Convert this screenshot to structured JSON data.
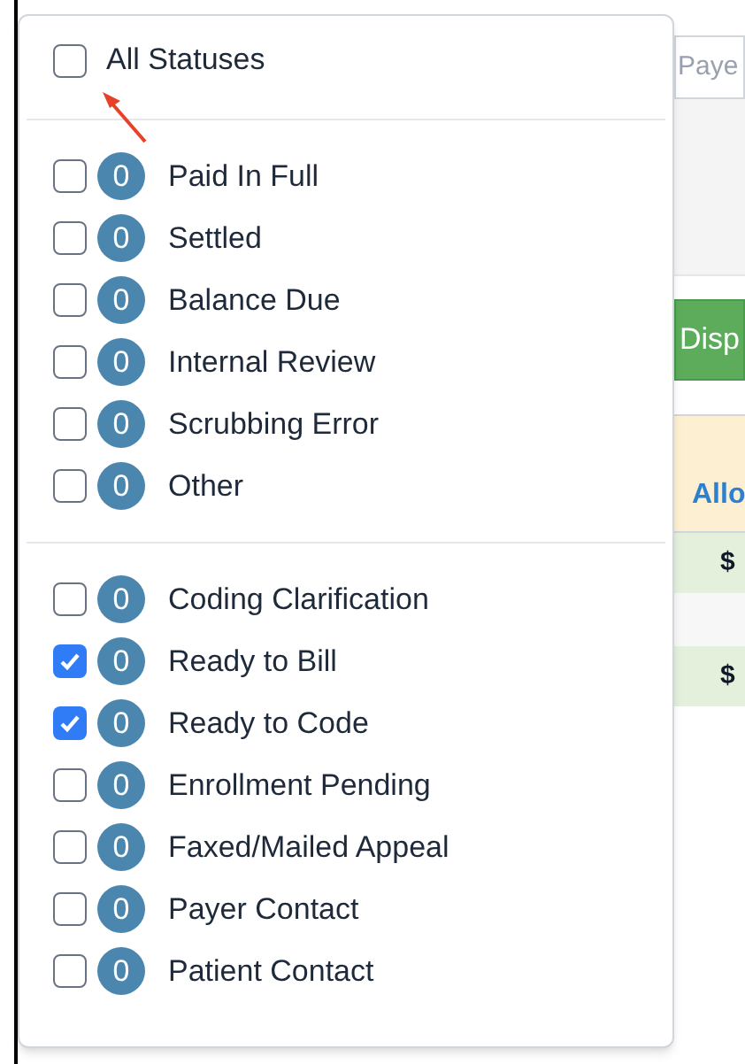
{
  "background": {
    "payer_field": {
      "placeholder": "Paye"
    },
    "display_button": "Disp",
    "table": {
      "column_header": "Allo",
      "rows": [
        {
          "cell": "$",
          "highlighted": true
        },
        {
          "cell": "",
          "highlighted": false
        },
        {
          "cell": "$",
          "highlighted": true
        }
      ]
    }
  },
  "status_menu": {
    "all_option": {
      "label": "All Statuses",
      "checked": false
    },
    "groups": [
      {
        "items": [
          {
            "count": "0",
            "label": "Paid In Full",
            "checked": false
          },
          {
            "count": "0",
            "label": "Settled",
            "checked": false
          },
          {
            "count": "0",
            "label": "Balance Due",
            "checked": false
          },
          {
            "count": "0",
            "label": "Internal Review",
            "checked": false
          },
          {
            "count": "0",
            "label": "Scrubbing Error",
            "checked": false
          },
          {
            "count": "0",
            "label": "Other",
            "checked": false
          }
        ]
      },
      {
        "items": [
          {
            "count": "0",
            "label": "Coding Clarification",
            "checked": false
          },
          {
            "count": "0",
            "label": "Ready to Bill",
            "checked": true
          },
          {
            "count": "0",
            "label": "Ready to Code",
            "checked": true
          },
          {
            "count": "0",
            "label": "Enrollment Pending",
            "checked": false
          },
          {
            "count": "0",
            "label": "Faxed/Mailed Appeal",
            "checked": false
          },
          {
            "count": "0",
            "label": "Payer Contact",
            "checked": false
          },
          {
            "count": "0",
            "label": "Patient Contact",
            "checked": false
          }
        ]
      }
    ]
  }
}
